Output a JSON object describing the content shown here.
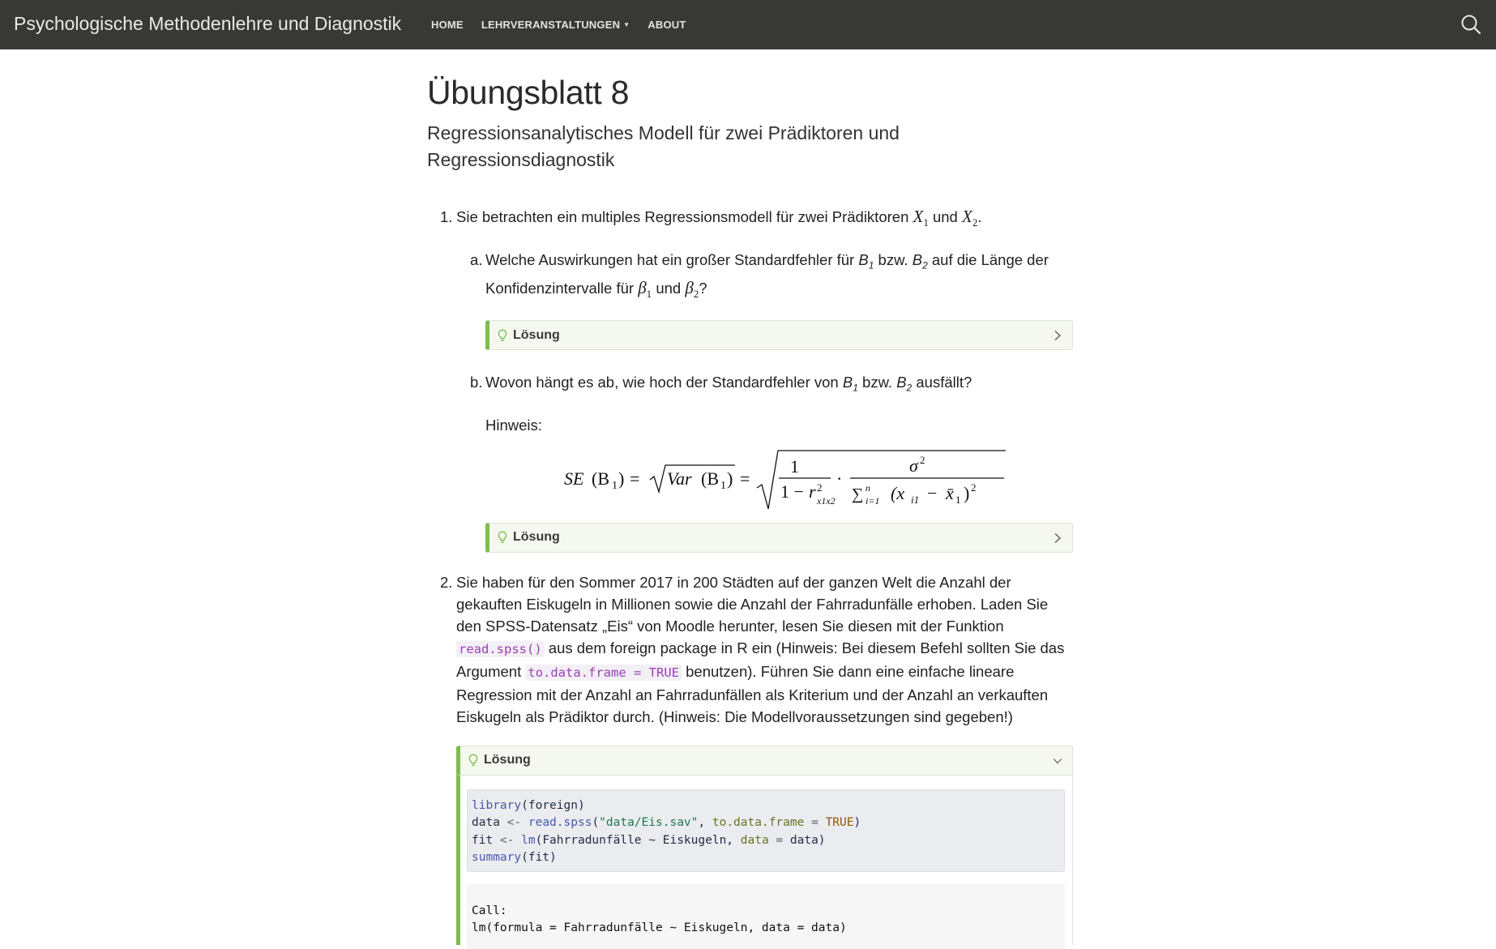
{
  "navbar": {
    "brand": "Psychologische Methodenlehre und Diagnostik",
    "links": [
      {
        "label": "HOME"
      },
      {
        "label": "LEHRVERANSTALTUNGEN",
        "dropdown": true
      },
      {
        "label": "ABOUT"
      }
    ],
    "search_icon": "search-icon"
  },
  "page": {
    "title": "Übungsblatt 8",
    "subtitle": "Regressionsanalytisches Modell für zwei Prädiktoren und Regressionsdiagnostik"
  },
  "q1": {
    "number": "1.",
    "text_before": "Sie betrachten ein multiples Regressionsmodell für zwei Prädiktoren",
    "and": "und",
    "x1": "X",
    "x1_sub": "1",
    "x2": "X",
    "x2_sub": "2",
    "end": ".",
    "a": {
      "letter": "a.",
      "t1": "Welche Auswirkungen hat ein großer Standardfehler für",
      "b1": "B",
      "b1_sub": "1",
      "bzw": "bzw.",
      "b2": "B",
      "b2_sub": "2",
      "t2": "auf die Länge der Konfidenzintervalle für",
      "beta1": "β",
      "beta1_sub": "1",
      "und": "und",
      "beta2": "β",
      "beta2_sub": "2",
      "end": "?"
    },
    "a_solution_label": "Lösung",
    "b": {
      "letter": "b.",
      "t1": "Wovon hängt es ab, wie hoch der Standardfehler von",
      "b1": "B",
      "b1_sub": "1",
      "bzw": "bzw.",
      "b2": "B",
      "b2_sub": "2",
      "t2": "ausfällt?",
      "hint": "Hinweis:"
    },
    "formula": {
      "lhs": "SE",
      "lhs_arg": "(B",
      "lhs_sub": "1",
      "lhs_close": ")",
      "eq1": "=",
      "var": "Var",
      "var_arg": "(B",
      "var_sub": "1",
      "var_close": ")",
      "eq2": "=",
      "one": "1",
      "denom1": "1 −",
      "r": "r",
      "r_sup": "2",
      "r_sub": "x1x2",
      "dot": "·",
      "sigma": "σ",
      "sigma_sup": "2",
      "sum": "∑",
      "sum_sup": "n",
      "sum_sub": "i=1",
      "paren": "(x",
      "x_sub": "i1",
      "minus": "−",
      "xbar": "x̄",
      "xbar_sub": "1",
      "close": ")",
      "sq": "2"
    },
    "b_solution_label": "Lösung"
  },
  "q2": {
    "number": "2.",
    "t1": "Sie haben für den Sommer 2017 in 200 Städten auf der ganzen Welt die Anzahl der gekauften Eiskugeln in Millionen sowie die Anzahl der Fahrradunfälle erhoben. Laden Sie den SPSS-Datensatz „Eis“ von Moodle herunter, lesen Sie diesen mit der Funktion",
    "code1": "read.spss()",
    "t2": "aus dem foreign package in R ein (Hinweis: Bei diesem Befehl sollten Sie das Argument",
    "code2": "to.data.frame = TRUE",
    "t3": "benutzen). Führen Sie dann eine einfache lineare Regression mit der Anzahl an Fahrradunfällen als Kriterium und der Anzahl an verkauften Eiskugeln als Prädiktor durch. (Hinweis: Die Modellvoraussetzungen sind gegeben!)",
    "solution_label": "Lösung",
    "code": {
      "l1_fn": "library",
      "l1_rest": "(foreign)",
      "l2_var": "data ",
      "l2_arrow": "<-",
      "l2_fn": " read.spss",
      "l2_open": "(",
      "l2_str": "\"data/Eis.sav\"",
      "l2_comma": ", ",
      "l2_arg": "to.data.frame",
      "l2_eq": " = ",
      "l2_kw": "TRUE",
      "l2_close": ")",
      "l3_var": "fit ",
      "l3_arrow": "<-",
      "l3_fn": " lm",
      "l3_mid": "(Fahrradunfälle ~ Eiskugeln, ",
      "l3_arg": "data",
      "l3_eq": " = ",
      "l3_end": "data)",
      "l4_fn": "summary",
      "l4_rest": "(fit)"
    },
    "output": {
      "line1": "Call:",
      "line2": "lm(formula = Fahrradunfälle ~ Eiskugeln, data = data)"
    }
  },
  "colors": {
    "navbar_bg": "#383834",
    "callout_accent": "#7cbd4f",
    "inline_code": "#9b3fb5"
  }
}
